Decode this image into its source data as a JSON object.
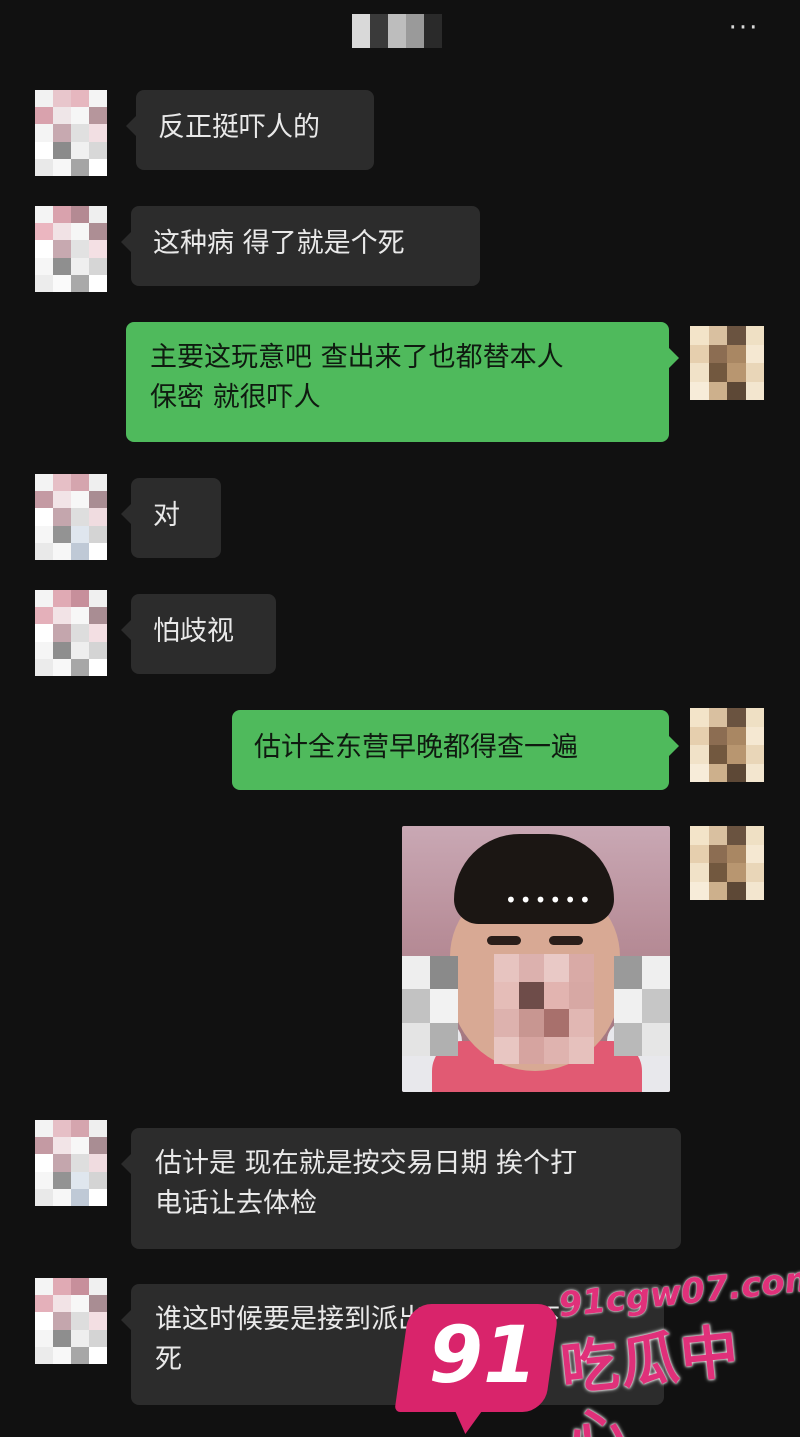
{
  "header": {
    "more_icon": "more-dots-icon",
    "more_label": "···"
  },
  "messages": [
    {
      "side": "in",
      "text": "反正挺吓人的"
    },
    {
      "side": "in",
      "text": "这种病 得了就是个死"
    },
    {
      "side": "out",
      "line1": "主要这玩意吧 查出来了也都替本人",
      "line2": "保密 就很吓人"
    },
    {
      "side": "in",
      "text": "对"
    },
    {
      "side": "in",
      "text": "怕歧视"
    },
    {
      "side": "out",
      "text": "估计全东营早晚都得查一遍"
    },
    {
      "side": "out",
      "type": "image",
      "caption_dots": "••••••"
    },
    {
      "side": "in",
      "line1": "估计是 现在就是按交易日期 挨个打",
      "line2": "电话让去体检"
    },
    {
      "side": "in",
      "line1": "谁这时候要是接到派出所电话得吓",
      "line2": "死"
    }
  ],
  "watermark": {
    "number": "91",
    "url": "91cgw07.com",
    "name": "吃瓜中心"
  },
  "colors": {
    "background": "#111111",
    "incoming_bubble": "#2c2c2c",
    "outgoing_bubble": "#4fba5c",
    "watermark_pink": "#d9246b"
  }
}
